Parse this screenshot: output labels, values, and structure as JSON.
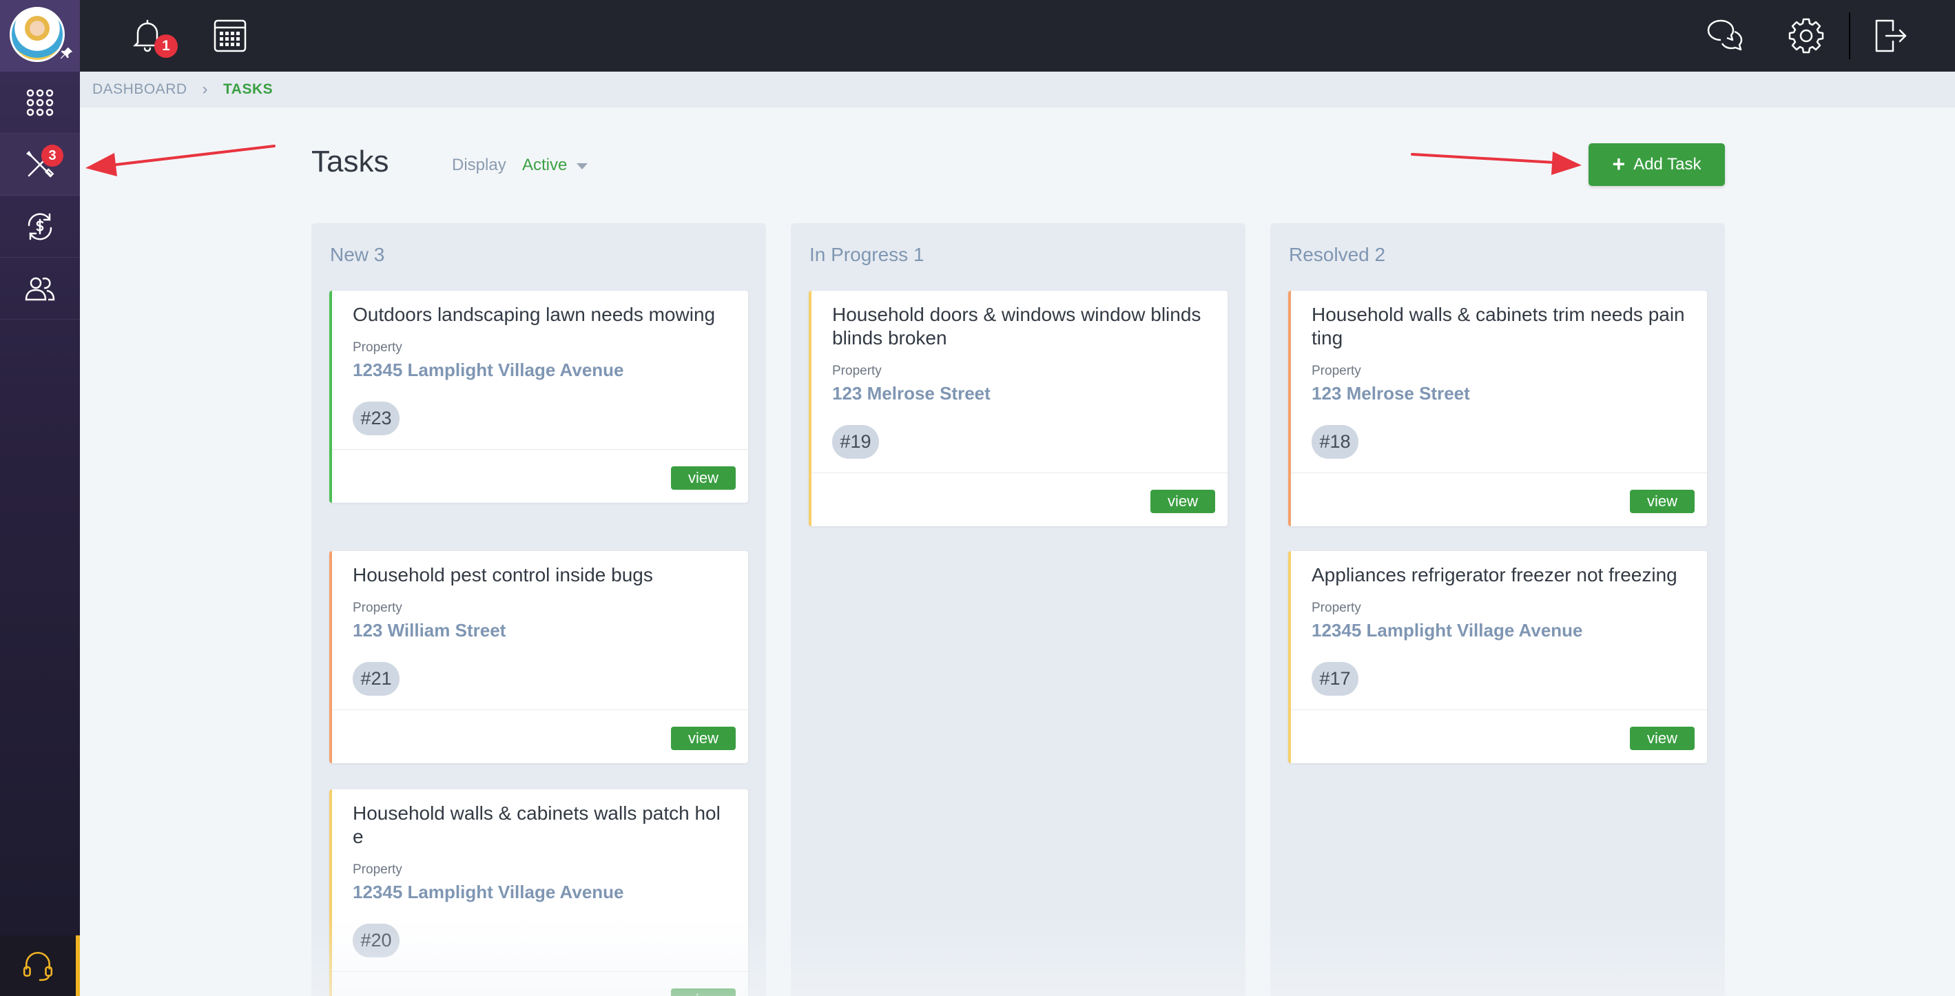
{
  "sidebar": {
    "items": [
      {
        "name": "apps",
        "icon": "grid-dots-icon"
      },
      {
        "name": "tasks",
        "icon": "tools-icon",
        "badge": "3"
      },
      {
        "name": "payments",
        "icon": "dollar-cycle-icon"
      },
      {
        "name": "contacts",
        "icon": "users-icon"
      }
    ],
    "support_icon": "headset-icon"
  },
  "topbar": {
    "notifications_badge": "1",
    "icons": [
      "bell-icon",
      "calendar-icon",
      "chat-icon",
      "gear-icon",
      "logout-icon"
    ]
  },
  "breadcrumb": {
    "root": "DASHBOARD",
    "current": "TASKS"
  },
  "header": {
    "title": "Tasks",
    "display_label": "Display",
    "display_value": "Active",
    "add_button": "Add Task"
  },
  "columns": [
    {
      "title": "New 3",
      "cards": [
        {
          "title": "Outdoors landscaping lawn needs mowing",
          "property_label": "Property",
          "property": "12345 Lamplight Village Avenue",
          "id": "#23",
          "view": "view"
        },
        {
          "title": "Household pest control inside bugs",
          "property_label": "Property",
          "property": "123 William Street",
          "id": "#21",
          "view": "view"
        },
        {
          "title": "Household walls & cabinets walls patch hole",
          "property_label": "Property",
          "property": "12345 Lamplight Village Avenue",
          "id": "#20",
          "view": "view"
        }
      ]
    },
    {
      "title": "In Progress 1",
      "cards": [
        {
          "title": "Household doors & windows window blinds blinds broken",
          "property_label": "Property",
          "property": "123 Melrose Street",
          "id": "#19",
          "view": "view"
        }
      ]
    },
    {
      "title": "Resolved 2",
      "cards": [
        {
          "title": "Household walls & cabinets trim needs painting",
          "property_label": "Property",
          "property": "123 Melrose Street",
          "id": "#18",
          "view": "view"
        },
        {
          "title": "Appliances refrigerator freezer not freezing",
          "property_label": "Property",
          "property": "12345 Lamplight Village Avenue",
          "id": "#17",
          "view": "view"
        }
      ]
    }
  ],
  "colors": {
    "accent_green": "#3a9e41",
    "badge_red": "#e5323e",
    "annotation_red": "#e8343f"
  }
}
